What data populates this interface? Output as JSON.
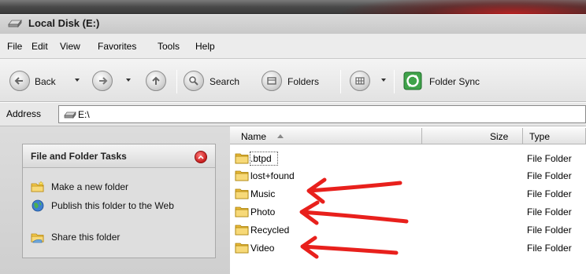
{
  "window": {
    "title": "Local Disk (E:)"
  },
  "menu": [
    "File",
    "Edit",
    "View",
    "Favorites",
    "Tools",
    "Help"
  ],
  "toolbar": {
    "back_label": "Back",
    "search_label": "Search",
    "folders_label": "Folders",
    "sync_label": "Folder Sync"
  },
  "address": {
    "label": "Address",
    "value": "E:\\"
  },
  "tasks": {
    "title": "File and Folder Tasks",
    "items": [
      "Make a new folder",
      "Publish this folder to the Web",
      "Share this folder"
    ]
  },
  "columns": {
    "name": "Name",
    "size": "Size",
    "type": "Type"
  },
  "files": [
    {
      "name": ".btpd",
      "type": "File Folder"
    },
    {
      "name": "lost+found",
      "type": "File Folder"
    },
    {
      "name": "Music",
      "type": "File Folder"
    },
    {
      "name": "Photo",
      "type": "File Folder"
    },
    {
      "name": "Recycled",
      "type": "File Folder"
    },
    {
      "name": "Video",
      "type": "File Folder"
    }
  ],
  "colors": {
    "annotation_red": "#e8201c",
    "folder_yellow": "#f2c94c"
  }
}
